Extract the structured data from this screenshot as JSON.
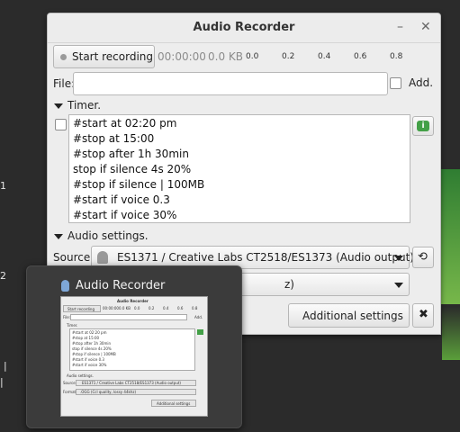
{
  "desktop": {
    "numbers": [
      "1",
      "2",
      "|",
      "|"
    ]
  },
  "window": {
    "title": "Audio Recorder",
    "minimize_glyph": "–",
    "close_glyph": "✕"
  },
  "recorder": {
    "start_label": "Start recording",
    "time": "00:00:00",
    "size": "0.0 KB",
    "meter_ticks": [
      "0.0",
      "0.2",
      "0.4",
      "0.6",
      "0.8"
    ]
  },
  "file": {
    "label": "File:",
    "value": "",
    "add_label": "Add."
  },
  "timer": {
    "header": "Timer.",
    "lines": [
      "#start at 02:20 pm",
      "#stop at 15:00",
      "#stop after 1h 30min",
      "stop if silence 4s 20%",
      "#stop if silence | 100MB",
      "#start if voice 0.3",
      "#start if voice 30%"
    ]
  },
  "audio_settings": {
    "header": "Audio settings.",
    "source_label": "Source:",
    "source_value": "ES1371 / Creative Labs CT2518/ES1373 (Audio output)",
    "format_visible_fragment": "z)",
    "additional_settings_label": "Additional settings"
  },
  "preview": {
    "title": "Audio Recorder",
    "thumb": {
      "title": "Audio Recorder",
      "start": "Start recording",
      "time": "00:00:00",
      "size": "0.0 KB",
      "ticks": [
        "0.0",
        "0.2",
        "0.4",
        "0.6",
        "0.8"
      ],
      "file": "File:",
      "add": "Add.",
      "timer": "Timer.",
      "lines": [
        "#start at 02:20 pm",
        "#stop at 15:00",
        "#stop after 1h 30min",
        "stop if silence 4s 20%",
        "#stop if silence | 100MB",
        "#start if voice 0.3",
        "#start if voice 30%"
      ],
      "audio": "Audio settings.",
      "source": "Source:",
      "source_value": "ES1371 / Creative Labs CT2518/ES1373 (Audio output)",
      "format": "Format:",
      "format_value": ".OGG (Ccl quality, lossy 44khz)",
      "additional": "Additional settings"
    }
  },
  "colors": {
    "accent_green": "#4caf50",
    "desktop_bg": "#2b2b2b"
  }
}
